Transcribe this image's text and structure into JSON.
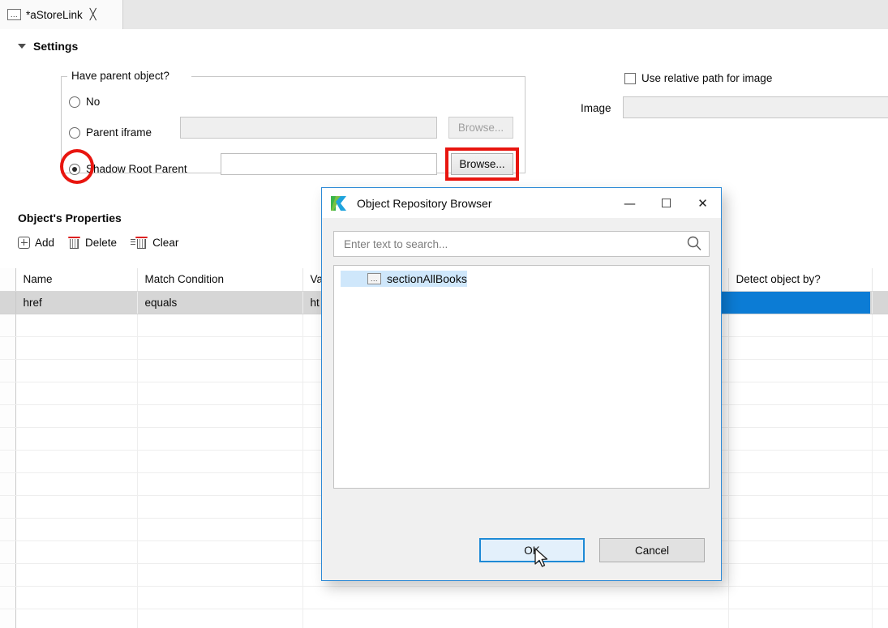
{
  "tab": {
    "icon": "object-icon",
    "label": "*aStoreLink",
    "close_label": "╳"
  },
  "settings": {
    "section_title": "Settings",
    "group_legend": "Have parent object?",
    "options": [
      {
        "label": "No",
        "selected": false
      },
      {
        "label": "Parent iframe",
        "selected": false
      },
      {
        "label": "Shadow Root Parent",
        "selected": true
      }
    ],
    "parent_iframe_value": "",
    "shadow_root_value": "",
    "browse_iframe_label": "Browse...",
    "browse_shadow_label": "Browse..."
  },
  "image_section": {
    "checkbox_label": "Use relative path for image",
    "checkbox_checked": false,
    "image_label": "Image",
    "image_value": ""
  },
  "properties": {
    "title": "Object's Properties",
    "toolbar": [
      {
        "icon": "plus-icon",
        "label": "Add"
      },
      {
        "icon": "trash-icon",
        "label": "Delete"
      },
      {
        "icon": "clear-trash-icon",
        "label": "Clear"
      }
    ],
    "columns": [
      "Name",
      "Match Condition",
      "Value",
      "Detect object by?"
    ],
    "rows": [
      {
        "name": "href",
        "match": "equals",
        "value": "ht",
        "detect": "",
        "selected": true
      }
    ],
    "empty_row_count": 14
  },
  "dialog": {
    "title": "Object Repository Browser",
    "logo": "katalon-logo-icon",
    "minimize_label": "—",
    "maximize_label": "☐",
    "close_label": "✕",
    "search_placeholder": "Enter text to search...",
    "search_value": "",
    "search_icon": "search-icon",
    "tree": [
      {
        "icon": "object-icon",
        "label": "sectionAllBooks",
        "selected": true
      }
    ],
    "ok_label": "OK",
    "cancel_label": "Cancel"
  },
  "annotations": {
    "radio_highlight": "red-ellipse",
    "browse_highlight": "red-rectangle",
    "accent_red": "#e8150f",
    "accent_blue": "#1e8ad6",
    "selection_blue": "#0c7cd5",
    "tree_selection": "#cfe7fb"
  }
}
